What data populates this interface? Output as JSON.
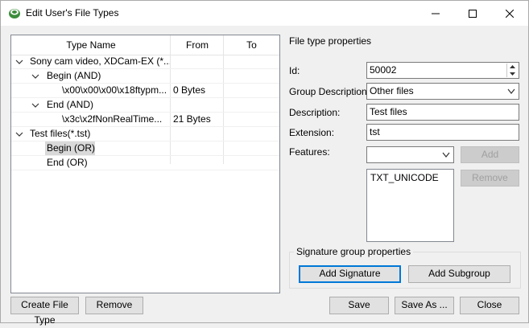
{
  "window": {
    "title": "Edit User's File Types"
  },
  "tree": {
    "columns": [
      "Type Name",
      "From",
      "To"
    ],
    "rows": [
      {
        "name": "Sony cam video, XDCam-EX (*...",
        "from": "",
        "to": "",
        "expander": "chevron-down-icon"
      },
      {
        "name": "Begin (AND)",
        "from": "",
        "to": "",
        "expander": "chevron-down-icon"
      },
      {
        "name": "\\x00\\x00\\x00\\x18ftypm...",
        "from": "0 Bytes",
        "to": ""
      },
      {
        "name": "End (AND)",
        "from": "",
        "to": "",
        "expander": "chevron-down-icon"
      },
      {
        "name": "\\x3c\\x2fNonRealTime...",
        "from": "21 Bytes",
        "to": ""
      },
      {
        "name": "Test files(*.tst)",
        "from": "",
        "to": "",
        "expander": "chevron-down-icon"
      },
      {
        "name": "Begin (OR)",
        "from": "",
        "to": "",
        "selected": true
      },
      {
        "name": "End (OR)",
        "from": "",
        "to": ""
      }
    ]
  },
  "properties": {
    "heading": "File type properties",
    "id_label": "Id:",
    "id_value": "50002",
    "group_label": "Group Description:",
    "group_value": "Other files",
    "description_label": "Description:",
    "description_value": "Test files",
    "extension_label": "Extension:",
    "extension_value": "tst",
    "features_label": "Features:",
    "features_value": "",
    "features_list": [
      "TXT_UNICODE"
    ],
    "add_label": "Add",
    "remove_feature_label": "Remove"
  },
  "signature_group": {
    "title": "Signature group properties",
    "add_signature_label": "Add Signature",
    "add_subgroup_label": "Add Subgroup"
  },
  "footer": {
    "create_label": "Create File Type",
    "remove_label": "Remove",
    "save_label": "Save",
    "save_as_label": "Save As ...",
    "close_label": "Close"
  },
  "colors": {
    "accent": "#0078d7",
    "selection": "#d9d9d9",
    "app_icon": "#3c8d3c"
  }
}
